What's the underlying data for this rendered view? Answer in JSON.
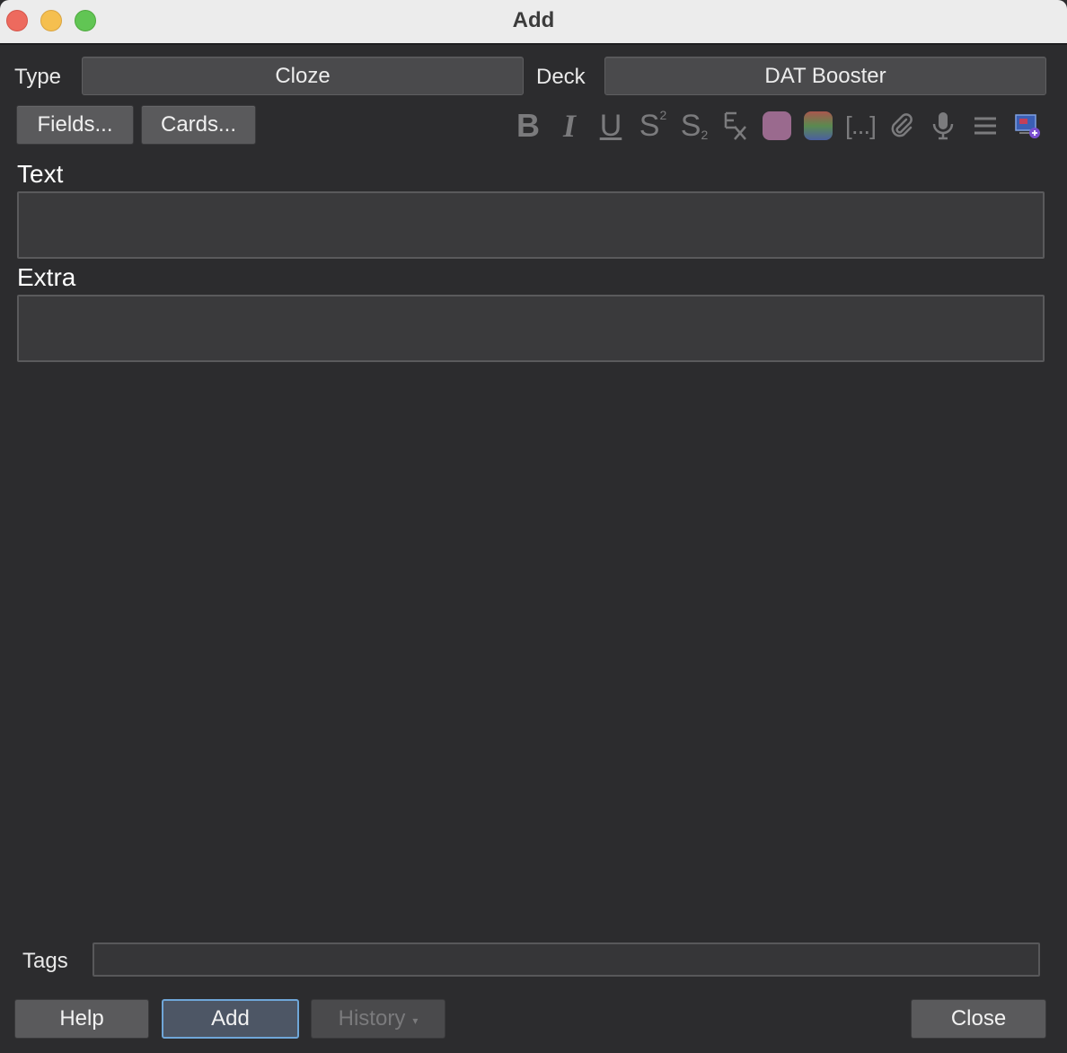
{
  "window": {
    "title": "Add"
  },
  "top": {
    "type_label": "Type",
    "type_value": "Cloze",
    "deck_label": "Deck",
    "deck_value": "DAT Booster"
  },
  "toolbar": {
    "fields_label": "Fields...",
    "cards_label": "Cards...",
    "superscript_base": "S",
    "superscript_mark": "2",
    "subscript_base": "S",
    "subscript_mark": "2",
    "cloze_label": "[...]",
    "icons": [
      "bold-icon",
      "italic-icon",
      "underline-icon",
      "superscript-icon",
      "subscript-icon",
      "clear-format-icon",
      "text-color-icon",
      "highlight-color-icon",
      "cloze-icon",
      "attach-icon",
      "record-audio-icon",
      "more-icon",
      "image-occlusion-icon"
    ],
    "colors": {
      "text_color": "#9a6a8e",
      "highlight_top": "#a9574e",
      "highlight_mid": "#5b8a4f",
      "highlight_bottom": "#4a5fa0"
    }
  },
  "fields": [
    {
      "label": "Text",
      "value": ""
    },
    {
      "label": "Extra",
      "value": ""
    }
  ],
  "tags": {
    "label": "Tags",
    "value": ""
  },
  "buttons": {
    "help": "Help",
    "add": "Add",
    "history": "History",
    "history_caret": "▾",
    "close": "Close"
  }
}
